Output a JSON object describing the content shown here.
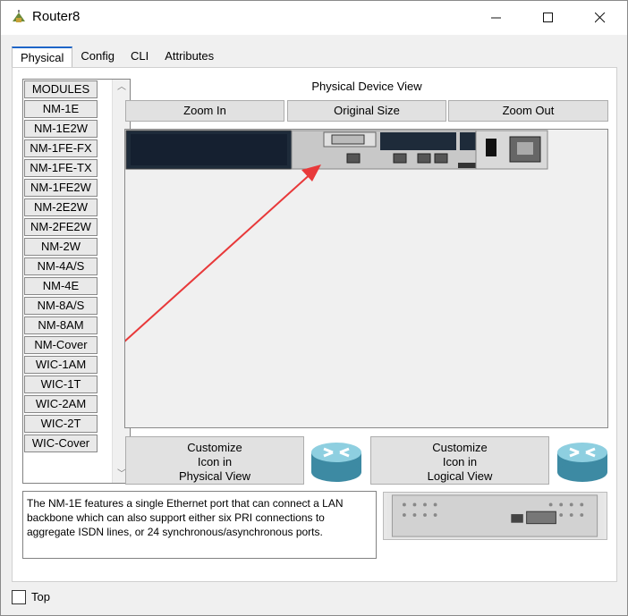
{
  "window": {
    "title": "Router8"
  },
  "titlebar_buttons": {
    "minimize": "—",
    "maximize": "☐",
    "close": "✕"
  },
  "tabs": [
    {
      "label": "Physical",
      "active": true
    },
    {
      "label": "Config",
      "active": false
    },
    {
      "label": "CLI",
      "active": false
    },
    {
      "label": "Attributes",
      "active": false
    }
  ],
  "modules": {
    "items": [
      "MODULES",
      "NM-1E",
      "NM-1E2W",
      "NM-1FE-FX",
      "NM-1FE-TX",
      "NM-1FE2W",
      "NM-2E2W",
      "NM-2FE2W",
      "NM-2W",
      "NM-4A/S",
      "NM-4E",
      "NM-8A/S",
      "NM-8AM",
      "NM-Cover",
      "WIC-1AM",
      "WIC-1T",
      "WIC-2AM",
      "WIC-2T",
      "WIC-Cover"
    ]
  },
  "device_view": {
    "label": "Physical Device View",
    "zoom_in": "Zoom In",
    "original_size": "Original Size",
    "zoom_out": "Zoom Out"
  },
  "customize": {
    "physical_line1": "Customize",
    "physical_line2": "Icon in",
    "physical_line3": "Physical View",
    "logical_line1": "Customize",
    "logical_line2": "Icon in",
    "logical_line3": "Logical View"
  },
  "description": "The NM-1E features a single Ethernet port that can connect a LAN backbone which can also support either six PRI connections to aggregate ISDN lines, or 24 synchronous/asynchronous ports.",
  "footer": {
    "top_label": "Top"
  },
  "colors": {
    "accent": "#1e66c8",
    "annotation_arrow": "#e8393a",
    "router_chassis": "#1e2b3a"
  }
}
